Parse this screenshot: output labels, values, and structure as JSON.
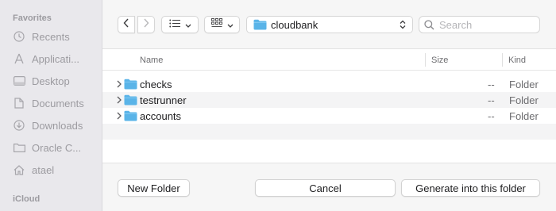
{
  "sidebar": {
    "favorites_heading": "Favorites",
    "items": [
      {
        "label": "Recents",
        "icon": "clock-icon"
      },
      {
        "label": "Applicati...",
        "icon": "applications-icon"
      },
      {
        "label": "Desktop",
        "icon": "desktop-icon"
      },
      {
        "label": "Documents",
        "icon": "document-icon"
      },
      {
        "label": "Downloads",
        "icon": "download-icon"
      },
      {
        "label": "Oracle C...",
        "icon": "folder-icon"
      },
      {
        "label": "atael",
        "icon": "home-icon"
      }
    ],
    "icloud_heading": "iCloud"
  },
  "toolbar": {
    "location": "cloudbank",
    "search_placeholder": "Search"
  },
  "list": {
    "headers": {
      "name": "Name",
      "size": "Size",
      "kind": "Kind"
    },
    "rows": [
      {
        "name": "checks",
        "size": "--",
        "kind": "Folder"
      },
      {
        "name": "testrunner",
        "size": "--",
        "kind": "Folder"
      },
      {
        "name": "accounts",
        "size": "--",
        "kind": "Folder"
      }
    ]
  },
  "footer": {
    "new_folder": "New Folder",
    "cancel": "Cancel",
    "generate": "Generate into this folder"
  },
  "colors": {
    "folder_blue": "#5ab4e8",
    "sidebar_bg": "#e9e8ec"
  }
}
